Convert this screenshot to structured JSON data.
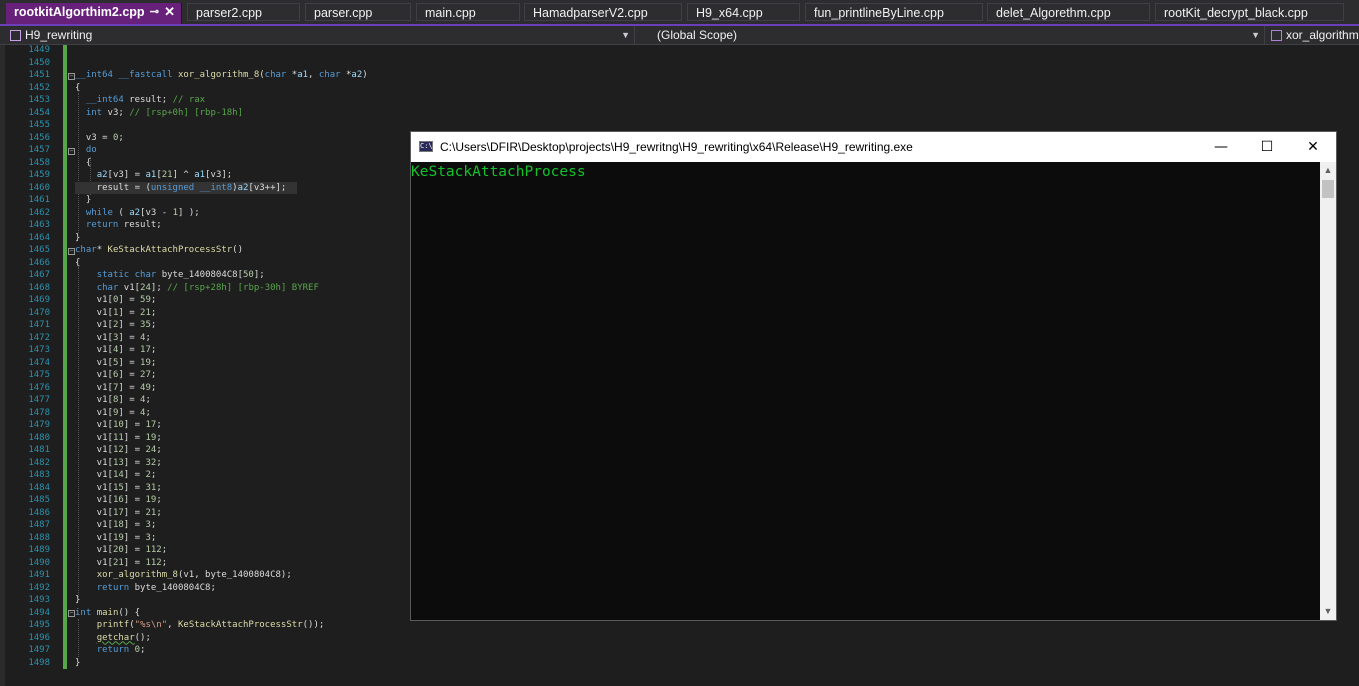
{
  "tabs": [
    {
      "label": "rootkitAlgorthim2.cpp",
      "pin": "⊸",
      "close": "✕"
    },
    {
      "label": "parser2.cpp"
    },
    {
      "label": "parser.cpp"
    },
    {
      "label": "main.cpp"
    },
    {
      "label": "HamadparserV2.cpp"
    },
    {
      "label": "H9_x64.cpp"
    },
    {
      "label": "fun_printlineByLine.cpp"
    },
    {
      "label": "delet_Algorethm.cpp"
    },
    {
      "label": "rootKit_decrypt_black.cpp"
    }
  ],
  "navbar": {
    "project": "H9_rewriting",
    "scope": "(Global Scope)",
    "member": "xor_algorithm"
  },
  "editor": {
    "line_numbers": [
      "1449",
      "1450",
      "1451",
      "1452",
      "1453",
      "1454",
      "1455",
      "1456",
      "1457",
      "1458",
      "1459",
      "1460",
      "1461",
      "1462",
      "1463",
      "1464",
      "1465",
      "1466",
      "1467",
      "1468",
      "1469",
      "1470",
      "1471",
      "1472",
      "1473",
      "1474",
      "1475",
      "1476",
      "1477",
      "1478",
      "1479",
      "1480",
      "1481",
      "1482",
      "1483",
      "1484",
      "1485",
      "1486",
      "1487",
      "1488",
      "1489",
      "1490",
      "1491",
      "1492",
      "1493",
      "1494",
      "1495",
      "1496",
      "1497",
      "1498"
    ]
  },
  "console": {
    "title": "C:\\Users\\DFIR\\Desktop\\projects\\H9_rewritng\\H9_rewriting\\x64\\Release\\H9_rewriting.exe",
    "icon_label": "C:\\",
    "output": "KeStackAttachProcess",
    "minimize": "—",
    "maximize": "☐",
    "close": "✕"
  },
  "colors": {
    "accent": "#68217a",
    "console_text": "#13c22a",
    "keyword": "#569cd6",
    "comment": "#57a64a"
  }
}
